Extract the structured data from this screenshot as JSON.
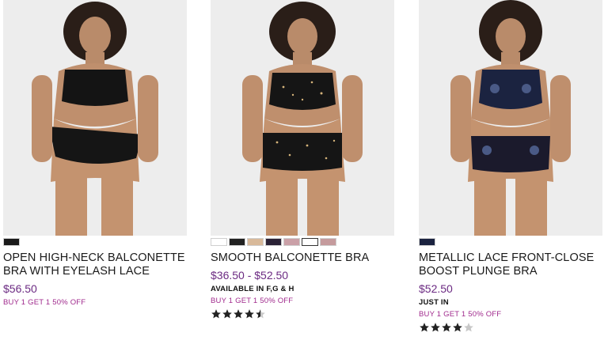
{
  "products": [
    {
      "title_line1": "OPEN HIGH-NECK BALCONETTE",
      "title_line2": "BRA WITH EYELASH LACE",
      "price": "$56.50",
      "availability": "",
      "promo": "BUY 1 GET 1 50% OFF",
      "rating": null,
      "swatches": [
        "#1a1a1a"
      ],
      "image_bg": "#ededed"
    },
    {
      "title_line1": "SMOOTH BALCONETTE BRA",
      "title_line2": "",
      "price": "$36.50 - $52.50",
      "availability": "AVAILABLE IN F,G & H",
      "promo": "BUY 1 GET 1 50% OFF",
      "rating": 4.5,
      "swatches": [
        "#ffffff",
        "#222222",
        "#d8b99a",
        "#2a2236",
        "#caa0a7",
        "#ffffff",
        "#c59b9d"
      ],
      "image_bg": "#ededed"
    },
    {
      "title_line1": "METALLIC LACE FRONT-CLOSE",
      "title_line2": "BOOST PLUNGE BRA",
      "price": "$52.50",
      "availability": "JUST IN",
      "promo": "BUY 1 GET 1 50% OFF",
      "rating": 4.0,
      "swatches": [
        "#1b2340"
      ],
      "image_bg": "#ededed"
    }
  ],
  "colors": {
    "price": "#6b2a82",
    "promo": "#a02a8d",
    "star_filled": "#222222",
    "star_empty": "#c8c8c8"
  }
}
